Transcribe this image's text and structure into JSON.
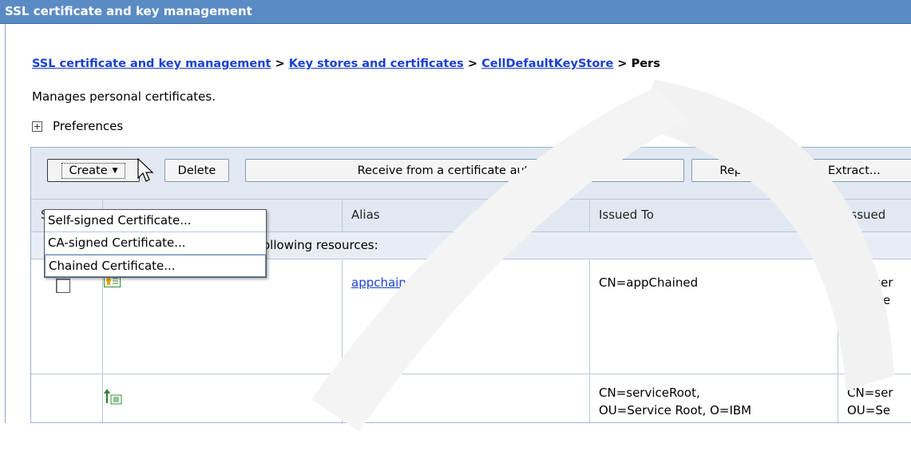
{
  "title": "SSL certificate and key management",
  "breadcrumb": {
    "items": [
      "SSL certificate and key management",
      "Key stores and certificates",
      "CellDefaultKeyStore"
    ],
    "separator": ">",
    "current": "Pers"
  },
  "description": "Manages personal certificates.",
  "preferences_label": "Preferences",
  "toolbar": {
    "create": "Create",
    "delete": "Delete",
    "receive": "Receive from a certificate authority...",
    "replace": "Replace...",
    "extract": "Extract..."
  },
  "create_menu": [
    "Self-signed Certificate...",
    "CA-signed Certificate...",
    "Chained Certificate..."
  ],
  "table": {
    "headers": {
      "select": "S",
      "alias": "Alias",
      "issued_to": "Issued To",
      "issued_by": "Issued"
    },
    "subheader": "ollowing resources:",
    "rows": [
      {
        "alias": "appchained",
        "issued_to": "CN=appChained",
        "issued_by_1": "CN=ser",
        "issued_by_2": "OU=Se",
        "icon": "personal-certificate-icon"
      },
      {
        "alias": "",
        "issued_to_1": "CN=serviceRoot,",
        "issued_to_2": "OU=Service Root, O=IBM",
        "issued_by_1": "CN=ser",
        "issued_by_2": "OU=Se",
        "icon": "root-certificate-icon"
      }
    ]
  },
  "colors": {
    "titlebar": "#5a8bc4",
    "link": "#1a3fd0",
    "toolbar_bg": "#e1e8f1"
  }
}
